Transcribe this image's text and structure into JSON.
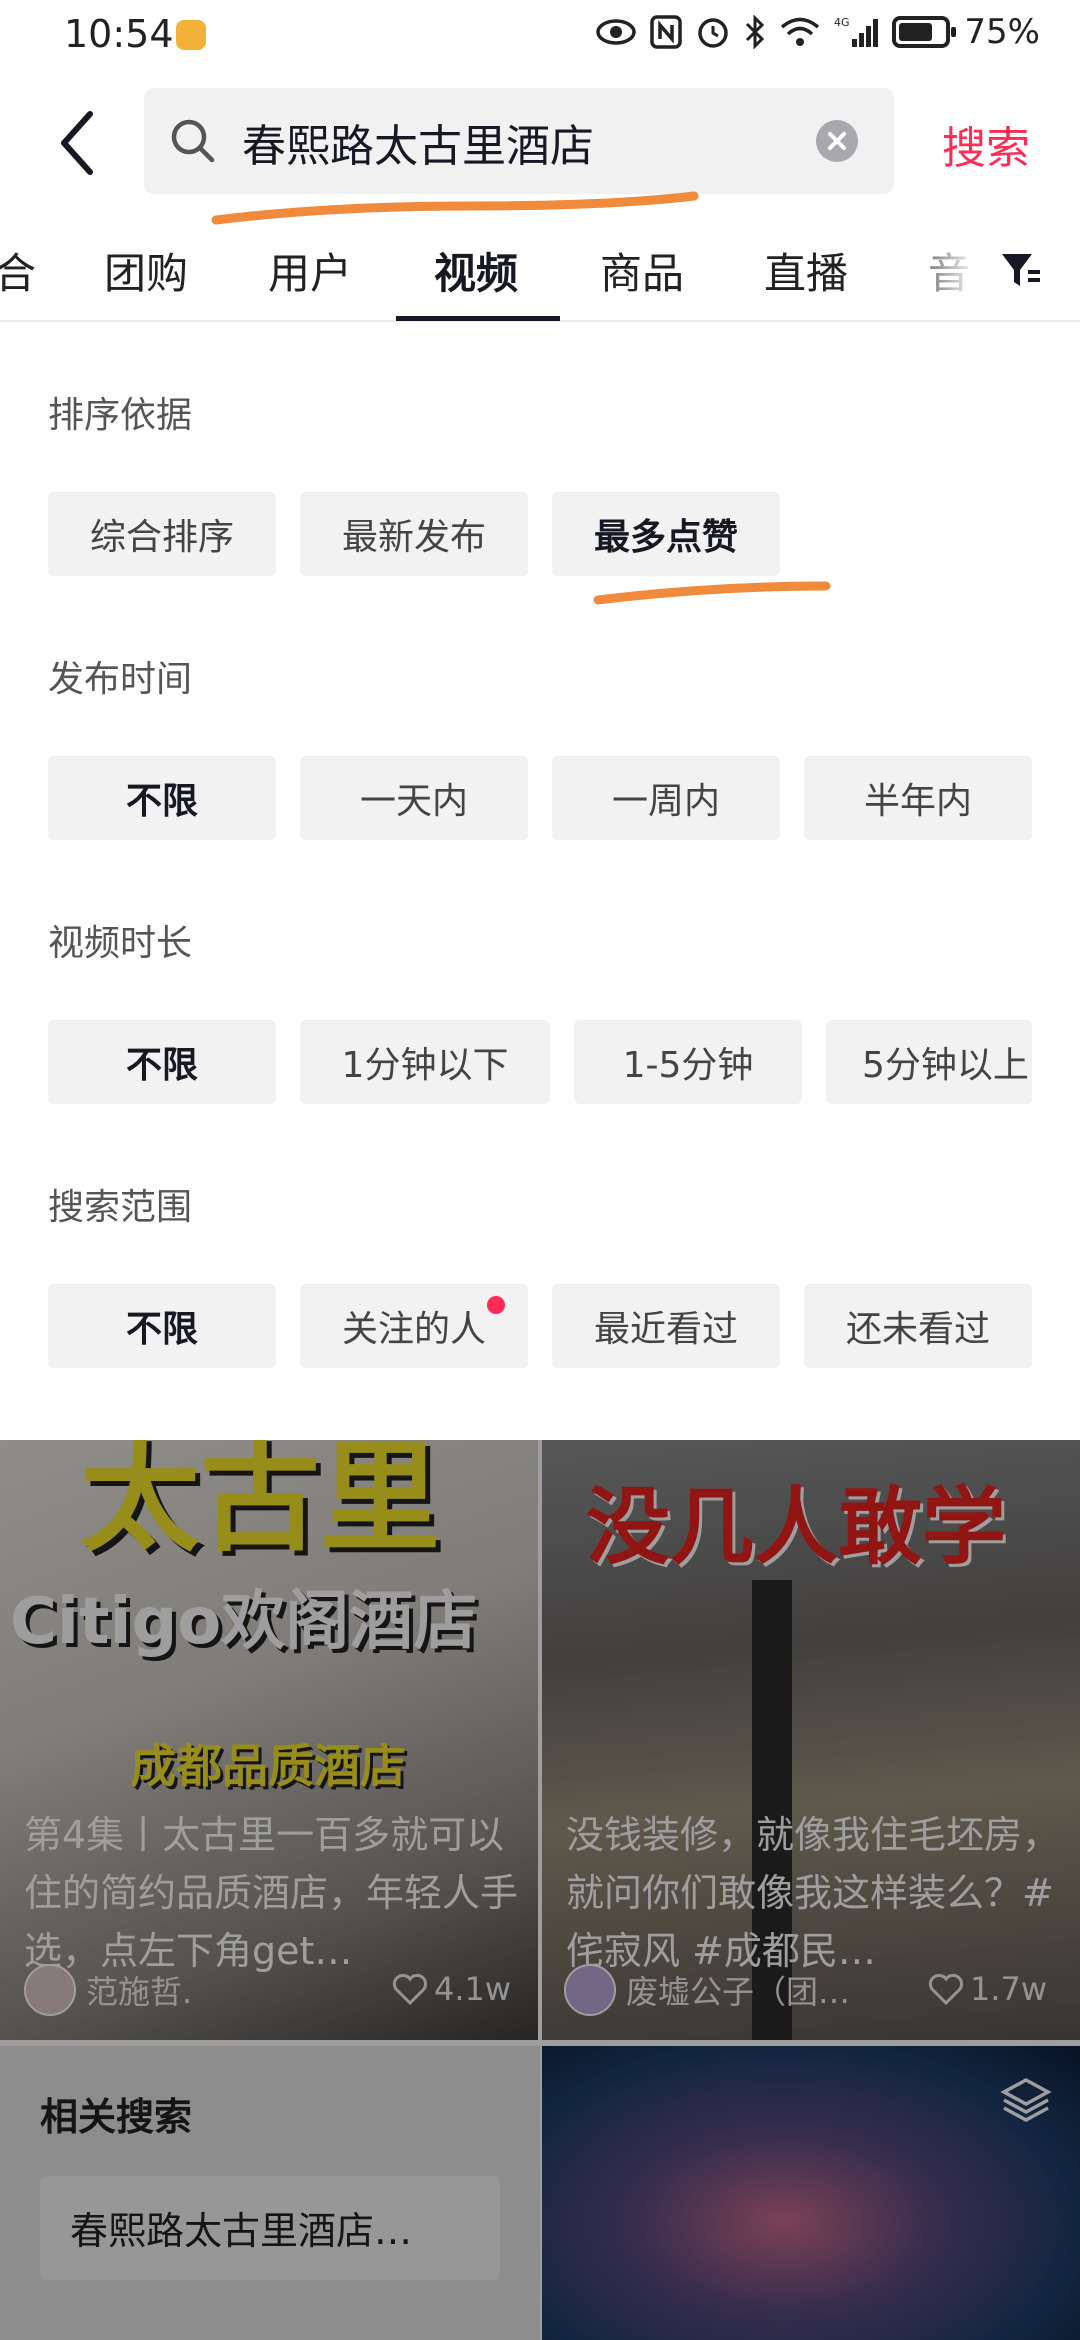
{
  "status_bar": {
    "time": "10:54",
    "battery": "75%",
    "battery_level": 0.75,
    "icons": [
      "eye-icon",
      "nfc-icon",
      "alarm-icon",
      "bluetooth-icon",
      "wifi-icon",
      "signal-4g-icon",
      "battery-icon"
    ]
  },
  "search": {
    "query": "春熙路太古里酒店",
    "button_label": "搜索"
  },
  "tabs": {
    "items": [
      "合",
      "团购",
      "用户",
      "视频",
      "商品",
      "直播",
      "音"
    ],
    "active": "视频"
  },
  "filters": {
    "sort": {
      "title": "排序依据",
      "options": [
        "综合排序",
        "最新发布",
        "最多点赞"
      ],
      "selected": "最多点赞"
    },
    "publish_time": {
      "title": "发布时间",
      "options": [
        "不限",
        "一天内",
        "一周内",
        "半年内"
      ],
      "selected": "不限"
    },
    "duration": {
      "title": "视频时长",
      "options": [
        "不限",
        "1分钟以下",
        "1-5分钟",
        "5分钟以上"
      ],
      "selected": "不限"
    },
    "scope": {
      "title": "搜索范围",
      "options": [
        "不限",
        "关注的人",
        "最近看过",
        "还未看过"
      ],
      "selected": "不限"
    }
  },
  "videos": [
    {
      "thumb_text_top": "太古里",
      "thumb_text_mid": "Citigo欢阁酒店",
      "thumb_text_low": "成都品质酒店",
      "caption": "第4集丨太古里一百多就可以住的简约品质酒店，年轻人手选，点左下角get…",
      "author": "范施哲.",
      "likes": "4.1w"
    },
    {
      "thumb_text_top": "没几人敢学",
      "caption": "没钱装修，就像我住毛坯房，就问你们敢像我这样装么？#侘寂风 #成都民…",
      "author": "废墟公子（团…",
      "likes": "1.7w"
    }
  ],
  "related": {
    "title": "相关搜索",
    "items": [
      "春熙路太古里酒店…"
    ]
  },
  "colors": {
    "accent": "#fe2c55",
    "annotation": "#f08a3c"
  }
}
